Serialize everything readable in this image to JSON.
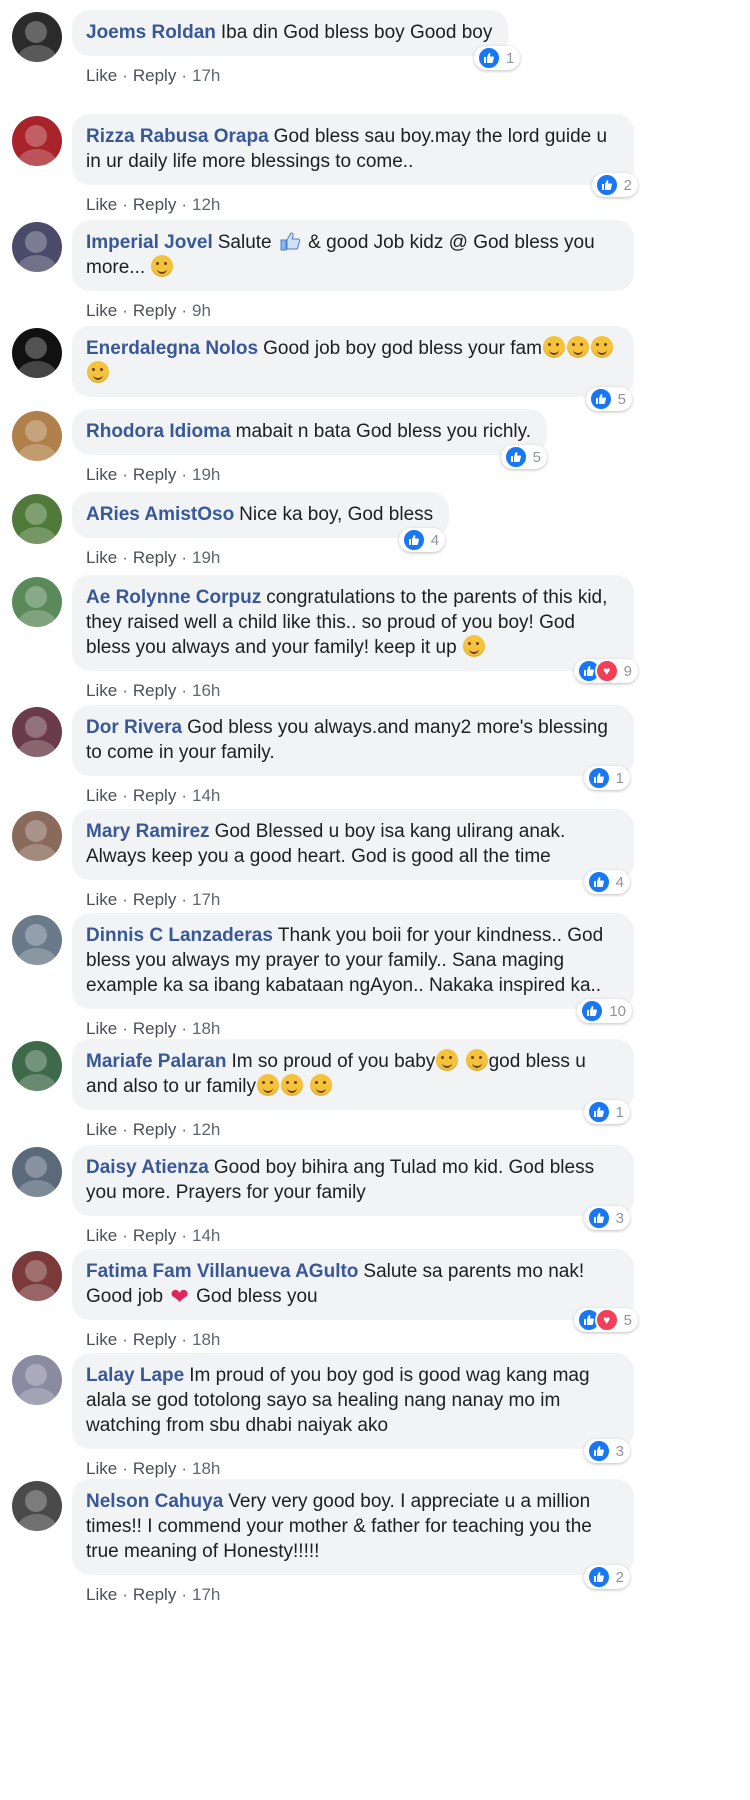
{
  "actions": {
    "like": "Like",
    "reply": "Reply",
    "sep": "·"
  },
  "colors": {
    "author": "#385898",
    "bubble": "#f2f3f5",
    "like": "#1877f2",
    "love": "#f33e58"
  },
  "icons": {
    "like": "like-thumb-icon",
    "love": "love-heart-icon"
  },
  "comments": [
    {
      "author": "Joems Roldan",
      "text": "Iba din God bless boy Good boy",
      "time": "17h",
      "reactions": [
        "like"
      ],
      "count": "1",
      "avatar": "#2b2b2b"
    },
    {
      "author": "Rizza Rabusa Orapa",
      "text": "God bless sau boy.may the lord guide u in ur daily life more blessings to come..",
      "time": "12h",
      "reactions": [
        "like"
      ],
      "count": "2",
      "avatar": "#a8232a"
    },
    {
      "author": "Imperial Jovel",
      "text_a": "Salute",
      "text_b": "& good Job kidz @ God bless you more...",
      "time": "9h",
      "reactions": [],
      "count": "",
      "avatar": "#4a4a6a"
    },
    {
      "author": "Enerdalegna Nolos",
      "text": "Good job boy god bless your fam",
      "time": "19h",
      "reactions": [
        "like"
      ],
      "count": "5",
      "avatar": "#111111"
    },
    {
      "author": "Rhodora Idioma",
      "text": "mabait n bata God bless you richly.",
      "time": "19h",
      "reactions": [
        "like"
      ],
      "count": "5",
      "avatar": "#b0804a"
    },
    {
      "author": "ARies AmistOso",
      "text": "Nice ka boy, God bless",
      "time": "19h",
      "reactions": [
        "like"
      ],
      "count": "4",
      "avatar": "#4f7a3a"
    },
    {
      "author": "Ae Rolynne Corpuz",
      "text": "congratulations to the parents of this kid, they raised well a child like this.. so proud of you boy! God bless you always and your family! keep it up",
      "time": "16h",
      "reactions": [
        "like",
        "love"
      ],
      "count": "9",
      "avatar": "#5b8a5a"
    },
    {
      "author": "Dor Rivera",
      "text": "God bless you always.and many2 more's blessing to come in your family.",
      "time": "14h",
      "reactions": [
        "like"
      ],
      "count": "1",
      "avatar": "#6a3b4a"
    },
    {
      "author": "Mary Ramirez",
      "text": "God Blessed u boy isa kang ulirang anak. Always keep you a good heart. God is good all the time",
      "time": "17h",
      "reactions": [
        "like"
      ],
      "count": "4",
      "avatar": "#8a6a5a"
    },
    {
      "author": "Dinnis C Lanzaderas",
      "text": "Thank you boii for your kindness.. God bless you always my prayer to your family.. Sana maging example ka sa ibang kabataan ngAyon.. Nakaka inspired ka..",
      "time": "18h",
      "reactions": [
        "like"
      ],
      "count": "10",
      "avatar": "#6a7a8a"
    },
    {
      "author": "Mariafe Palaran",
      "text_a": "Im so proud of you baby",
      "text_b": "god bless u and also to ur family",
      "time": "12h",
      "reactions": [
        "like"
      ],
      "count": "1",
      "avatar": "#3f6a4a"
    },
    {
      "author": "Daisy Atienza",
      "text": "Good boy bihira ang Tulad mo kid. God bless you more. Prayers for your family",
      "time": "14h",
      "reactions": [
        "like"
      ],
      "count": "3",
      "avatar": "#5a6a7a"
    },
    {
      "author": "Fatima Fam Villanueva AGulto",
      "text_a": "Salute sa parents mo nak! Good job",
      "text_b": "God bless you",
      "time": "18h",
      "reactions": [
        "like",
        "love"
      ],
      "count": "5",
      "avatar": "#7a3a3a"
    },
    {
      "author": "Lalay Lape",
      "text": "Im proud of you boy god is good wag kang mag alala se god totolong sayo sa healing nang nanay mo im watching from sbu dhabi naiyak ako",
      "time": "18h",
      "reactions": [
        "like"
      ],
      "count": "3",
      "avatar": "#8a8aa0"
    },
    {
      "author": "Nelson Cahuya",
      "text": "Very very good boy. I appreciate u a million times!! I commend your mother & father for teaching you the true meaning of Honesty!!!!!",
      "time": "17h",
      "reactions": [
        "like"
      ],
      "count": "2",
      "avatar": "#4a4a4a"
    }
  ]
}
